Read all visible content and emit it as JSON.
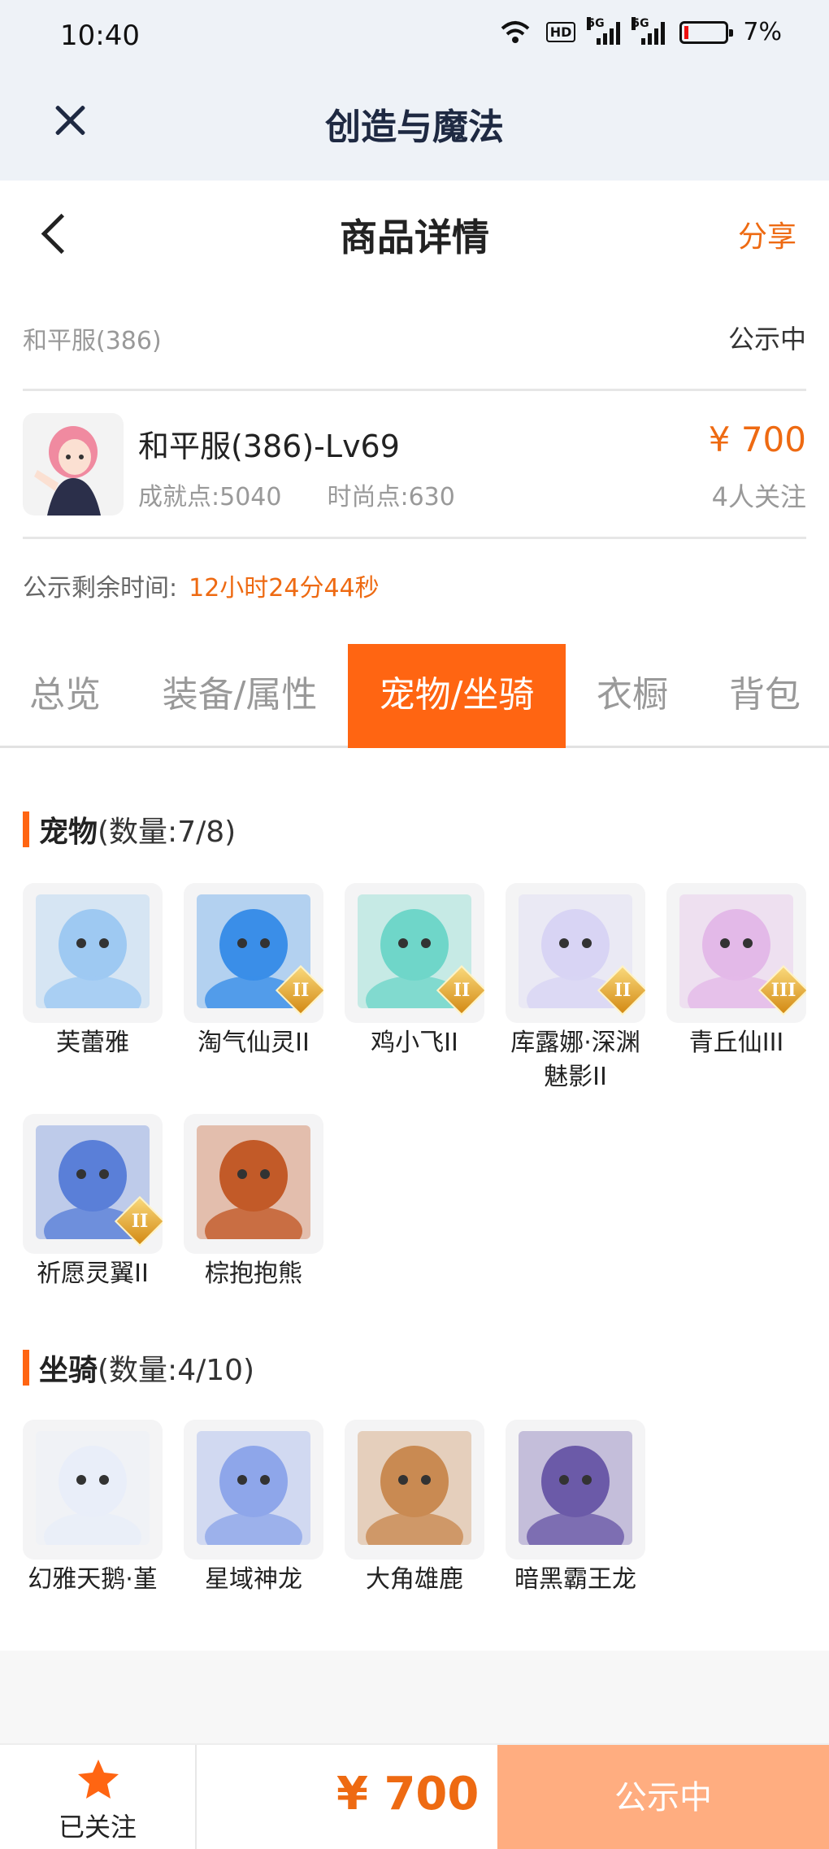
{
  "status_bar": {
    "time": "10:40",
    "network_1": "5G",
    "network_2": "5G",
    "hd_badge": "HD",
    "battery": "7%"
  },
  "app_header": {
    "title": "创造与魔法"
  },
  "page_header": {
    "title": "商品详情",
    "share": "分享"
  },
  "server": {
    "name": "和平服(386)",
    "status": "公示中"
  },
  "item": {
    "name": "和平服(386)-Lv69",
    "achievement": "成就点:5040",
    "fashion": "时尚点:630",
    "price": "¥ 700",
    "followers": "4人关注"
  },
  "countdown": {
    "label": "公示剩余时间:",
    "value": "12小时24分44秒"
  },
  "tabs": [
    {
      "label": "总览",
      "active": false
    },
    {
      "label": "装备/属性",
      "active": false
    },
    {
      "label": "宠物/坐骑",
      "active": true
    },
    {
      "label": "衣橱",
      "active": false
    },
    {
      "label": "背包",
      "active": false
    }
  ],
  "pets": {
    "title": "宠物",
    "count": "(数量:7/8)",
    "items": [
      {
        "name": "芙蕾雅",
        "rank": "",
        "color": "#9ec9f2"
      },
      {
        "name": "淘气仙灵II",
        "rank": "II",
        "color": "#3a8ee8"
      },
      {
        "name": "鸡小飞II",
        "rank": "II",
        "color": "#6fd6c9"
      },
      {
        "name": "库露娜·深渊魅影II",
        "rank": "II",
        "color": "#d8d4f4"
      },
      {
        "name": "青丘仙III",
        "rank": "III",
        "color": "#e3b9e8"
      },
      {
        "name": "祈愿灵翼II",
        "rank": "II",
        "color": "#5a7fd8"
      },
      {
        "name": "棕抱抱熊",
        "rank": "",
        "color": "#c25a28"
      }
    ]
  },
  "mounts": {
    "title": "坐骑",
    "count": "(数量:4/10)",
    "items": [
      {
        "name": "幻雅天鹅·堇",
        "color": "#e9eef9"
      },
      {
        "name": "星域神龙",
        "color": "#8ea6ea"
      },
      {
        "name": "大角雄鹿",
        "color": "#c98a52"
      },
      {
        "name": "暗黑霸王龙",
        "color": "#6b5aa8"
      }
    ]
  },
  "bottom_bar": {
    "follow_label": "已关注",
    "price": "¥ 700",
    "status_button": "公示中",
    "accent": "#ff6512"
  }
}
